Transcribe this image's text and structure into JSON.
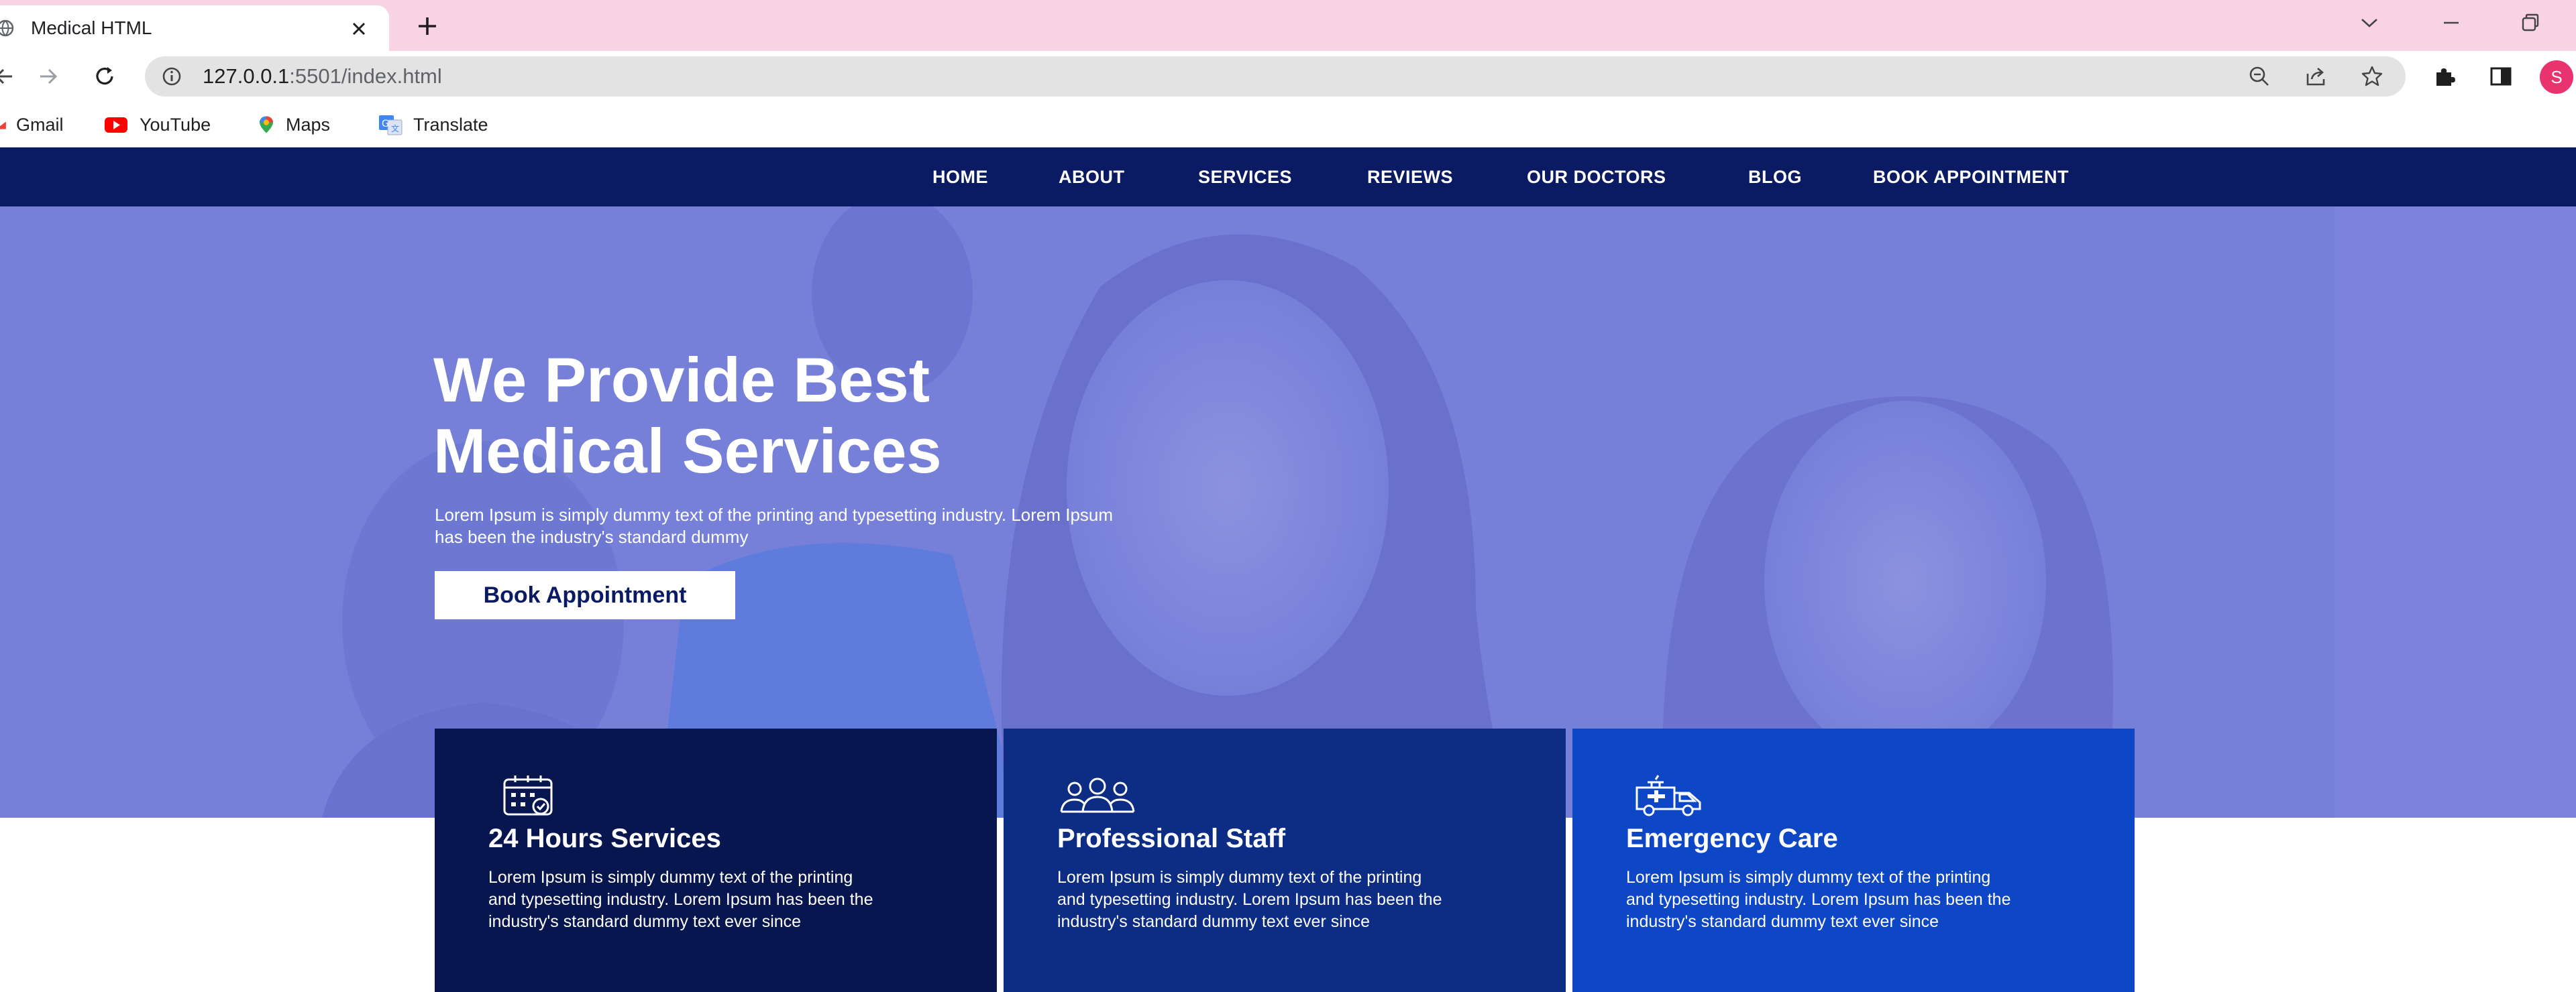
{
  "browser": {
    "tab_title": "Medical HTML",
    "url_host": "127.0.0.1",
    "url_rest": ":5501/index.html",
    "profile_initial": "S",
    "bookmarks": [
      {
        "label": "Gmail",
        "icon": "gmail-icon"
      },
      {
        "label": "YouTube",
        "icon": "youtube-icon"
      },
      {
        "label": "Maps",
        "icon": "maps-icon"
      },
      {
        "label": "Translate",
        "icon": "translate-icon"
      }
    ]
  },
  "nav": {
    "links": [
      "HOME",
      "ABOUT",
      "SERVICES",
      "REVIEWS",
      "OUR DOCTORS",
      "BLOG",
      "BOOK APPOINTMENT"
    ]
  },
  "hero": {
    "title_line1": "We Provide Best",
    "title_line2": "Medical Services",
    "text_line1": "Lorem Ipsum is simply dummy text of the printing and typesetting industry. Lorem Ipsum",
    "text_line2": "has been the industry's standard dummy",
    "button": "Book Appointment"
  },
  "cards": [
    {
      "icon": "calendar-icon",
      "title": "24 Hours Services",
      "text_line1": "Lorem Ipsum is simply dummy text of the printing",
      "text_line2": "and typesetting industry. Lorem Ipsum has been the",
      "text_line3": "industry's standard dummy text ever since",
      "color": "#08164f"
    },
    {
      "icon": "staff-group-icon",
      "title": "Professional Staff",
      "text_line1": "Lorem Ipsum is simply dummy text of the printing",
      "text_line2": "and typesetting industry. Lorem Ipsum has been the",
      "text_line3": "industry's standard dummy text ever since",
      "color": "#0d2d85"
    },
    {
      "icon": "ambulance-icon",
      "title": "Emergency Care",
      "text_line1": "Lorem Ipsum is simply dummy text of the printing",
      "text_line2": "and typesetting industry. Lorem Ipsum has been the",
      "text_line3": "industry's standard dummy text ever since",
      "color": "#0e47c6"
    }
  ],
  "colors": {
    "nav_bg": "#0b1b63",
    "hero_overlay": "#7680d9",
    "tabstrip_bg": "#f7d3e3"
  }
}
